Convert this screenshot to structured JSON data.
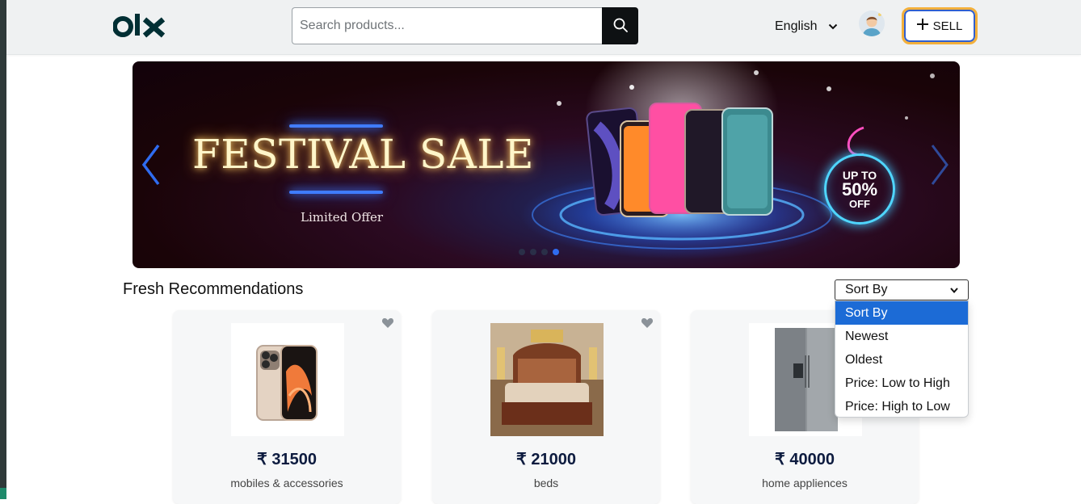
{
  "header": {
    "logo_text": "OLX",
    "search": {
      "placeholder": "Search products...",
      "value": ""
    },
    "search_icon": "search-icon",
    "language": "English",
    "sell_label": "SELL"
  },
  "banner": {
    "title": "FESTIVAL SALE",
    "subtitle": "Limited Offer",
    "badge": {
      "line1": "UP TO",
      "line2": "50%",
      "line3": "OFF"
    },
    "active_slide": 3,
    "slide_count": 4
  },
  "main": {
    "section_title": "Fresh Recommendations",
    "sort": {
      "selected": "Sort By",
      "options": [
        "Sort By",
        "Newest",
        "Oldest",
        "Price: Low to High",
        "Price: High to Low"
      ]
    },
    "products": [
      {
        "price": "₹ 31500",
        "category": "mobiles & accessories"
      },
      {
        "price": "₹ 21000",
        "category": "beds"
      },
      {
        "price": "₹ 40000",
        "category": "home appliences"
      }
    ]
  },
  "colors": {
    "header_bg": "#eff1f2",
    "search_button": "#0e1113",
    "sell_border": "#f3b03b",
    "sell_inner": "#2f5fd0",
    "selected_option": "#1c6bd6",
    "price_text": "#0d1b3f"
  }
}
